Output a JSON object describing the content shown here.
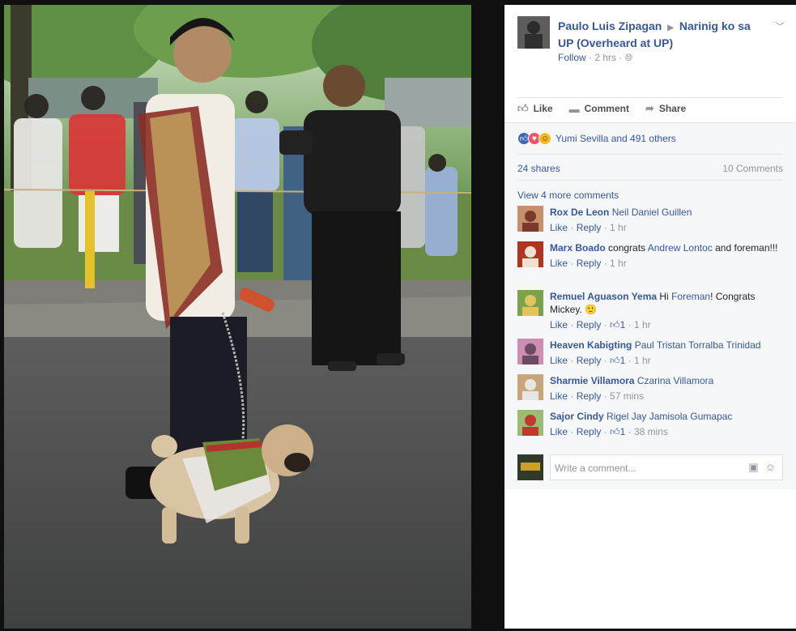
{
  "post": {
    "author": "Paulo Luis Zipagan",
    "separator": "▶",
    "group": "Narinig ko sa UP (Overheard at UP)",
    "follow": "Follow",
    "time": "2 hrs",
    "privacy_icon": "globe-icon",
    "menu_icon": "chevron-down-icon"
  },
  "actions": {
    "like": "Like",
    "comment": "Comment",
    "share": "Share"
  },
  "reactions": {
    "types": [
      "like",
      "love",
      "haha"
    ],
    "summary": "Yumi Sevilla and 491 others"
  },
  "counts": {
    "shares": "24 shares",
    "comments": "10 Comments"
  },
  "view_more": "View 4 more comments",
  "comments": [
    {
      "author": "Rox De Leon",
      "text_parts": [
        {
          "t": "Neil Daniel Guillen",
          "mention": true
        }
      ],
      "like": "Like",
      "reply": "Reply",
      "likes": "",
      "time": "1 hr"
    },
    {
      "author": "Marx Boado",
      "text_parts": [
        {
          "t": " congrats ",
          "mention": false
        },
        {
          "t": "Andrew Lontoc",
          "mention": true
        },
        {
          "t": " and foreman!!!",
          "mention": false
        }
      ],
      "like": "Like",
      "reply": "Reply",
      "likes": "",
      "time": "1 hr"
    },
    {
      "author": "Remuel Aguason Yema",
      "text_parts": [
        {
          "t": " Hi ",
          "mention": false
        },
        {
          "t": "Foreman",
          "mention": true
        },
        {
          "t": "! Congrats Mickey. 🙂",
          "mention": false
        }
      ],
      "like": "Like",
      "reply": "Reply",
      "likes": "1",
      "time": "1 hr"
    },
    {
      "author": "Heaven Kabigting",
      "text_parts": [
        {
          "t": "Paul Tristan Torralba Trinidad",
          "mention": true
        }
      ],
      "like": "Like",
      "reply": "Reply",
      "likes": "1",
      "time": "1 hr"
    },
    {
      "author": "Sharmie Villamora",
      "text_parts": [
        {
          "t": "Czarina Villamora",
          "mention": true
        }
      ],
      "like": "Like",
      "reply": "Reply",
      "likes": "",
      "time": "57 mins"
    },
    {
      "author": "Sajor Cindy",
      "text_parts": [
        {
          "t": "Rigel Jay Jamisola Gumapac",
          "mention": true
        }
      ],
      "like": "Like",
      "reply": "Reply",
      "likes": "1",
      "time": "38 mins"
    }
  ],
  "compose": {
    "placeholder": "Write a comment...",
    "camera_icon": "camera-icon",
    "emoji_icon": "emoji-icon"
  },
  "colors": {
    "link": "#365899",
    "muted": "#90949c",
    "like_blue": "#4267b2",
    "love_red": "#f25268",
    "haha_yellow": "#f7b928"
  }
}
